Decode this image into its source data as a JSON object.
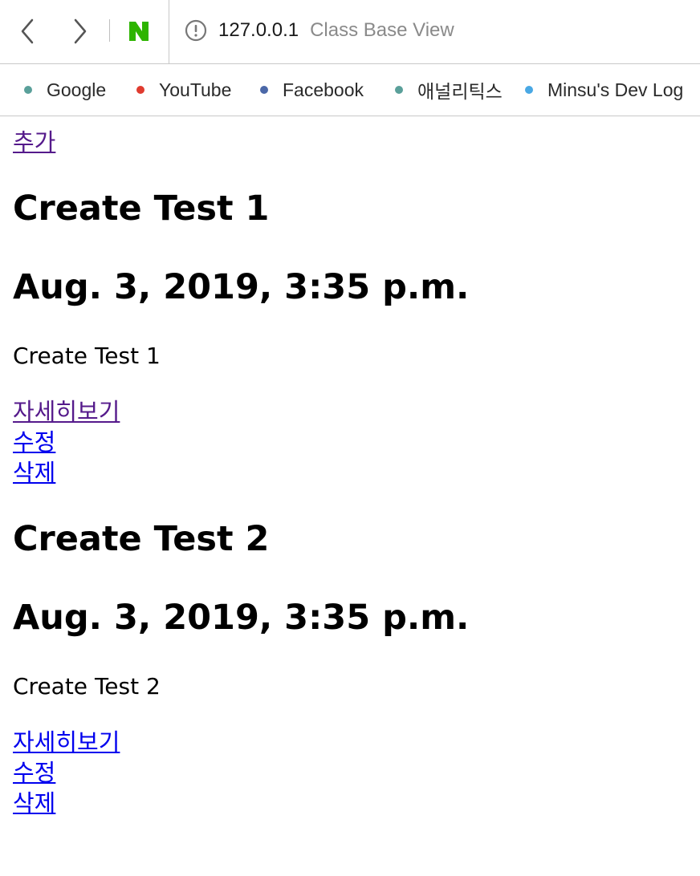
{
  "browser": {
    "address_host": "127.0.0.1",
    "address_title": "Class Base View",
    "bookmarks": [
      {
        "label": "Google",
        "color": "#5aa09a"
      },
      {
        "label": "YouTube",
        "color": "#e03b2f"
      },
      {
        "label": "Facebook",
        "color": "#4b68a8"
      },
      {
        "label": "애널리틱스",
        "color": "#5aa09a"
      },
      {
        "label": "Minsu's Dev Log",
        "color": "#49a8e4"
      }
    ]
  },
  "page": {
    "add_link": "추가",
    "posts": [
      {
        "title": "Create Test 1",
        "date": "Aug. 3, 2019, 3:35 p.m.",
        "body": "Create Test 1",
        "detail_link": "자세히보기",
        "edit_link": "수정",
        "delete_link": "삭제"
      },
      {
        "title": "Create Test 2",
        "date": "Aug. 3, 2019, 3:35 p.m.",
        "body": "Create Test 2",
        "detail_link": "자세히보기",
        "edit_link": "수정",
        "delete_link": "삭제"
      }
    ]
  }
}
